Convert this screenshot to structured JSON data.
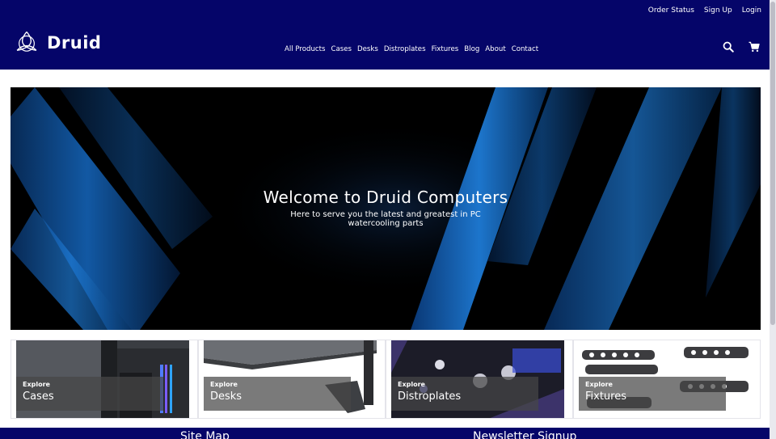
{
  "header": {
    "top_links": [
      "Order Status",
      "Sign Up",
      "Login"
    ],
    "brand": "Druid",
    "nav": [
      "All Products",
      "Cases",
      "Desks",
      "Distroplates",
      "Fixtures",
      "Blog",
      "About",
      "Contact"
    ],
    "icons": [
      "search-icon",
      "cart-icon"
    ],
    "background_color": "#050569"
  },
  "hero": {
    "title": "Welcome to Druid Computers",
    "subtitle": "Here to serve you the latest and greatest in PC watercooling parts"
  },
  "categories": [
    {
      "explore": "Explore",
      "name": "Cases"
    },
    {
      "explore": "Explore",
      "name": "Desks"
    },
    {
      "explore": "Explore",
      "name": "Distroplates"
    },
    {
      "explore": "Explore",
      "name": "Fixtures"
    }
  ],
  "footer": {
    "site_map": "Site Map",
    "newsletter": "Newsletter Signup"
  }
}
